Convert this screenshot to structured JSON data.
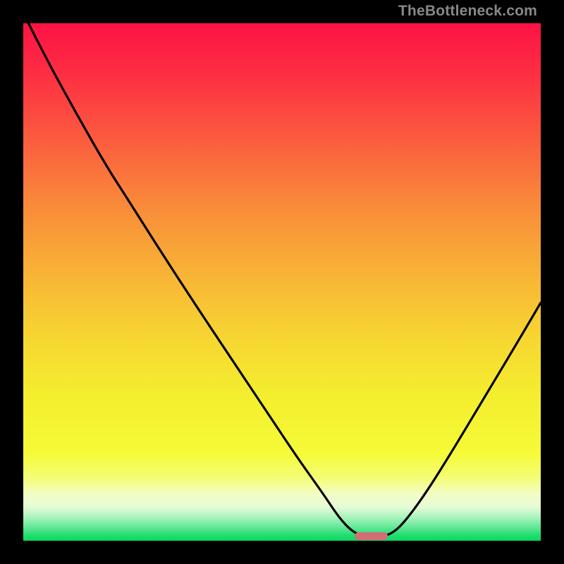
{
  "watermark": "TheBottleneck.com",
  "gradient_stops": [
    {
      "offset": 0.0,
      "color": "#fd1245"
    },
    {
      "offset": 0.1,
      "color": "#fd2f42"
    },
    {
      "offset": 0.22,
      "color": "#fb5a3f"
    },
    {
      "offset": 0.35,
      "color": "#f98a3a"
    },
    {
      "offset": 0.48,
      "color": "#f8b236"
    },
    {
      "offset": 0.6,
      "color": "#f7d432"
    },
    {
      "offset": 0.72,
      "color": "#f4ee2e"
    },
    {
      "offset": 0.83,
      "color": "#f5fb36"
    },
    {
      "offset": 0.88,
      "color": "#f4fd79"
    },
    {
      "offset": 0.91,
      "color": "#f3fdc5"
    },
    {
      "offset": 0.935,
      "color": "#e5fbd6"
    },
    {
      "offset": 0.955,
      "color": "#a9f3bd"
    },
    {
      "offset": 0.975,
      "color": "#5ee794"
    },
    {
      "offset": 0.99,
      "color": "#1fdd6f"
    },
    {
      "offset": 1.0,
      "color": "#08d95f"
    }
  ],
  "chart_data": {
    "type": "line",
    "title": "",
    "xlabel": "",
    "ylabel": "",
    "xlim": [
      0,
      100
    ],
    "ylim": [
      0,
      100
    ],
    "note": "x and y are in percent of plot area; y=0 at bottom, y=100 at top",
    "series": [
      {
        "name": "bottleneck-curve",
        "points": [
          {
            "x": 0.0,
            "y": 102.0
          },
          {
            "x": 4.0,
            "y": 94.0
          },
          {
            "x": 10.0,
            "y": 83.0
          },
          {
            "x": 16.0,
            "y": 72.5
          },
          {
            "x": 20.5,
            "y": 65.5
          },
          {
            "x": 26.0,
            "y": 56.8
          },
          {
            "x": 33.0,
            "y": 46.0
          },
          {
            "x": 40.0,
            "y": 35.5
          },
          {
            "x": 47.0,
            "y": 25.0
          },
          {
            "x": 53.0,
            "y": 16.0
          },
          {
            "x": 58.0,
            "y": 9.0
          },
          {
            "x": 61.0,
            "y": 4.5
          },
          {
            "x": 63.5,
            "y": 1.8
          },
          {
            "x": 66.0,
            "y": 0.7
          },
          {
            "x": 69.0,
            "y": 0.7
          },
          {
            "x": 71.5,
            "y": 1.5
          },
          {
            "x": 74.0,
            "y": 4.0
          },
          {
            "x": 78.0,
            "y": 9.5
          },
          {
            "x": 83.0,
            "y": 17.5
          },
          {
            "x": 89.0,
            "y": 27.5
          },
          {
            "x": 95.0,
            "y": 37.5
          },
          {
            "x": 100.0,
            "y": 46.0
          }
        ]
      }
    ],
    "marker": {
      "x_start": 64.0,
      "x_end": 70.5,
      "y": 0.9,
      "color": "#d16d74"
    }
  }
}
